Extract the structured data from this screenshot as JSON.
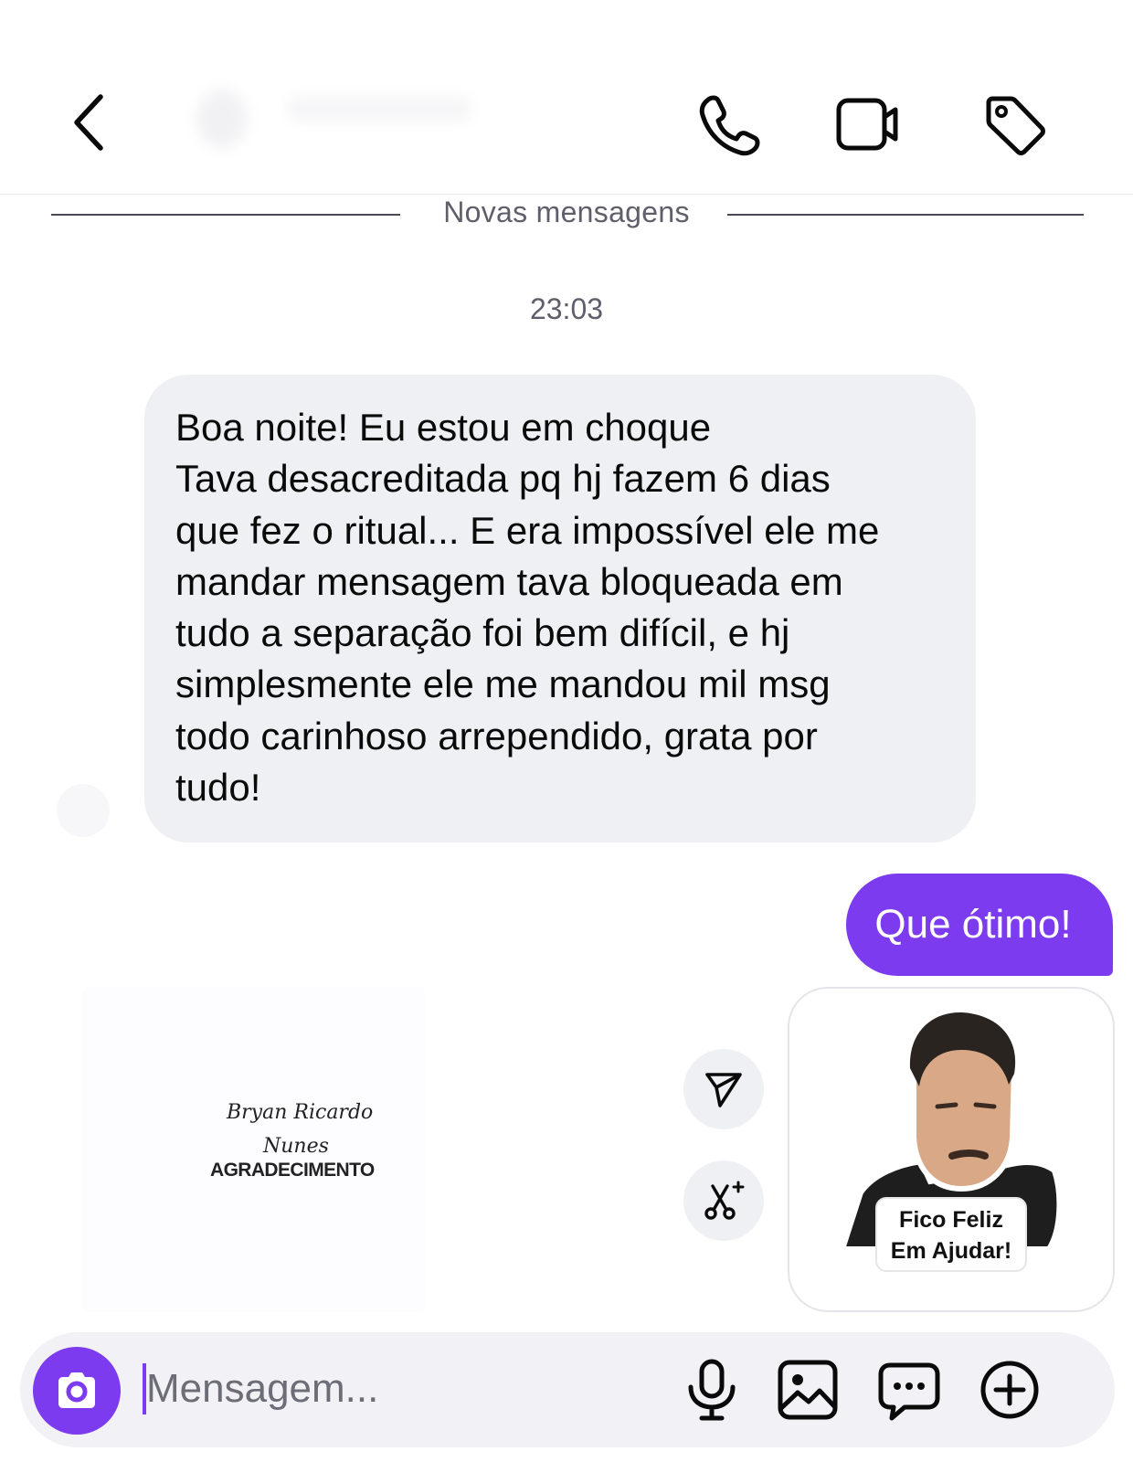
{
  "header": {
    "back_icon": "chevron-left-icon",
    "call_icon": "phone-icon",
    "video_icon": "video-camera-icon",
    "tag_icon": "tag-icon"
  },
  "thread": {
    "new_messages_label": "Novas mensagens",
    "timestamp": "23:03",
    "incoming_lines": [
      "Boa noite! Eu estou em choque",
      "Tava desacreditada pq hj fazem 6 dias",
      "que fez o ritual... E era impossível ele me",
      "mandar mensagem tava bloqueada em",
      "tudo a separação foi bem difícil, e hj",
      "simplesmente ele me mandou mil msg",
      "todo carinhoso arrependido, grata por",
      "tudo!"
    ],
    "outgoing_text": "Que ótimo!",
    "shared_card": {
      "signature_line1": "Bryan Ricardo",
      "signature_line2": "Nunes",
      "caption": "AGRADECIMENTO"
    },
    "sticker": {
      "line1": "Fico Feliz",
      "line2": "Em Ajudar!"
    },
    "actions": {
      "share_icon": "send-icon",
      "remix_icon": "scissors-sparkle-icon"
    }
  },
  "composer": {
    "placeholder": "Mensagem...",
    "camera_icon": "camera-icon",
    "mic_icon": "microphone-icon",
    "gallery_icon": "image-icon",
    "chat_icon": "chat-bubble-icon",
    "add_icon": "plus-circle-icon"
  },
  "colors": {
    "accent": "#7d3bef",
    "incoming_bubble": "#eef0f4",
    "secondary_text": "#5f5f6b"
  }
}
